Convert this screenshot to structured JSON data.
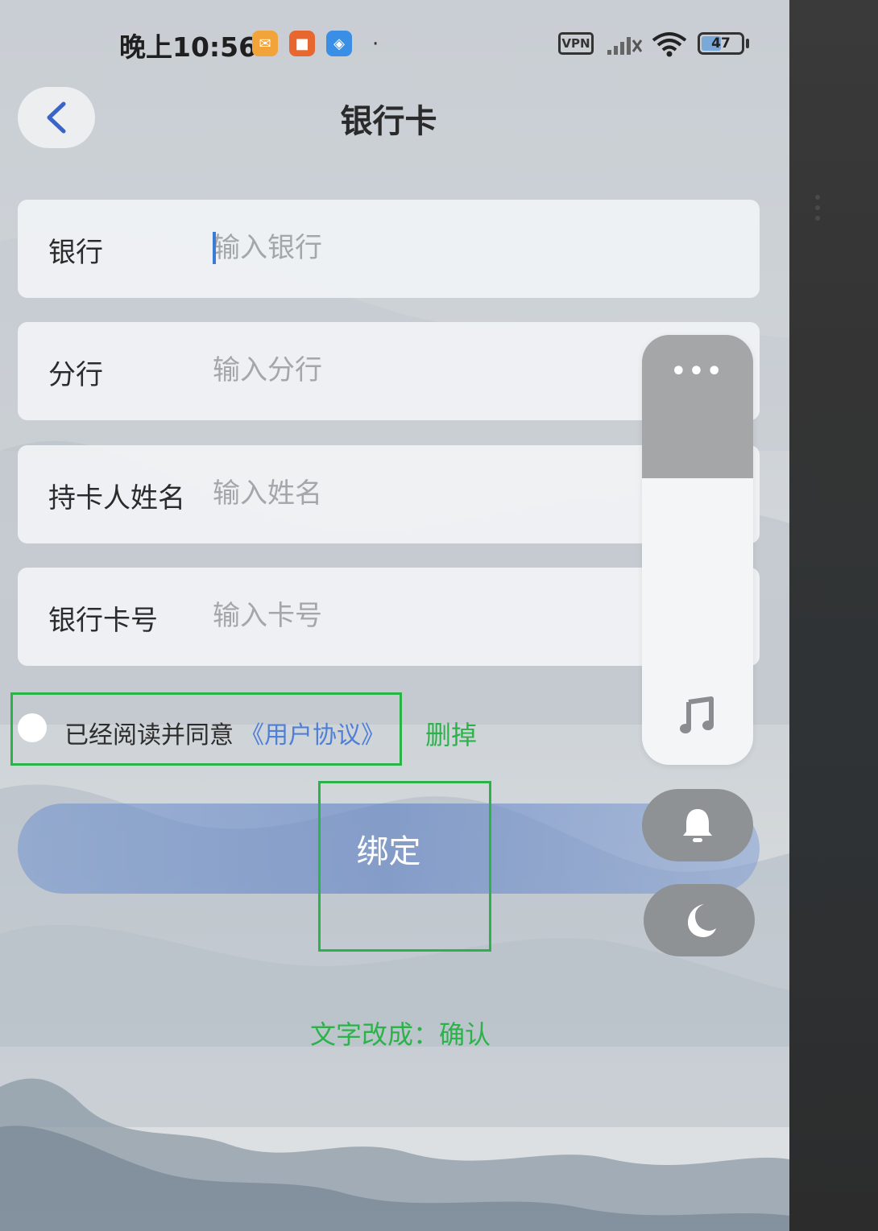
{
  "status_bar": {
    "time": "晚上10:56",
    "vpn": "VPN",
    "battery": "47",
    "dot": "·"
  },
  "header": {
    "title": "银行卡"
  },
  "form": {
    "rows": [
      {
        "label": "银行",
        "placeholder": "输入银行"
      },
      {
        "label": "分行",
        "placeholder": "输入分行"
      },
      {
        "label": "持卡人姓名",
        "placeholder": "输入姓名"
      },
      {
        "label": "银行卡号",
        "placeholder": "输入卡号"
      }
    ]
  },
  "agreement": {
    "text": "已经阅读并同意",
    "link": "《用户协议》"
  },
  "bind_button": {
    "label": "绑定"
  },
  "annotations": {
    "delete_note": "删掉",
    "rename_note": "文字改成：确认",
    "color": "#2bb34a"
  },
  "floating_panel": {
    "more": "•••",
    "icons": [
      "music-icon",
      "bell-icon",
      "moon-icon"
    ]
  },
  "colors": {
    "accent": "#4f7fd6",
    "button": "#7092ce",
    "annotation": "#2bb34a"
  }
}
